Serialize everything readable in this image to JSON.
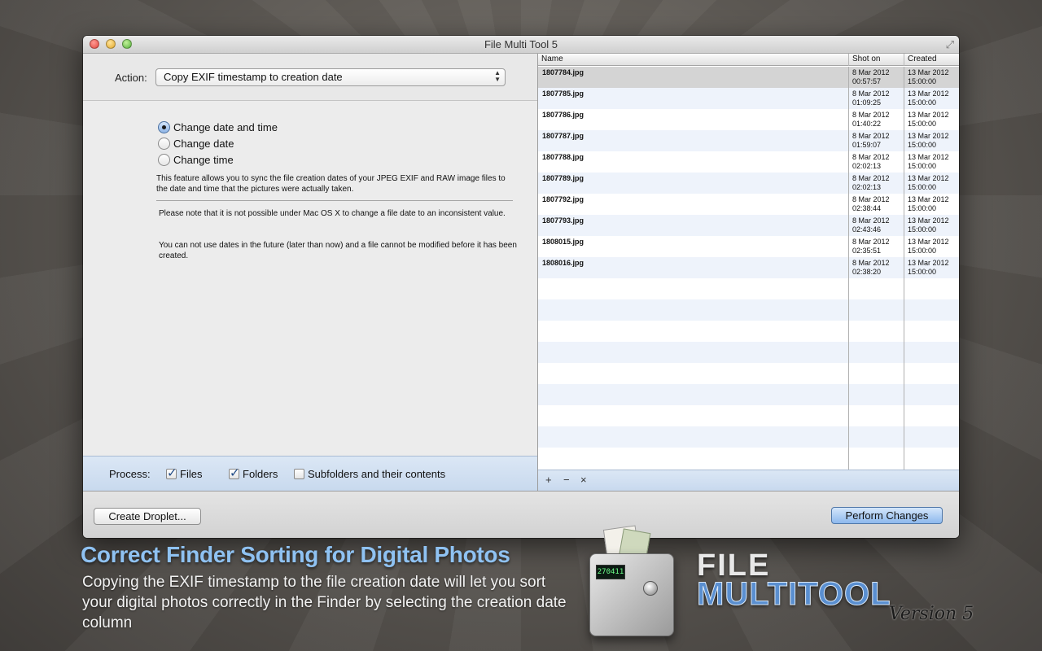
{
  "window": {
    "title": "File Multi Tool 5"
  },
  "action": {
    "label": "Action:",
    "selected": "Copy EXIF timestamp to creation date"
  },
  "radios": [
    {
      "label": "Change date and time",
      "selected": true
    },
    {
      "label": "Change date",
      "selected": false
    },
    {
      "label": "Change time",
      "selected": false
    }
  ],
  "description": "This feature allows you to sync the file creation dates of your JPEG EXIF and RAW image files to the date and time that the pictures were actually taken.",
  "notes": [
    "Please note that it is not possible under Mac OS X to change a file date to an inconsistent value.",
    "You can not use dates in the future (later than now) and a file cannot be modified before it has been created."
  ],
  "process": {
    "label": "Process:",
    "options": [
      {
        "label": "Files",
        "checked": true
      },
      {
        "label": "Folders",
        "checked": true
      },
      {
        "label": "Subfolders and their contents",
        "checked": false
      }
    ]
  },
  "table": {
    "columns": [
      "Name",
      "Shot on",
      "Created"
    ],
    "rows": [
      {
        "name": "1807784.jpg",
        "shot_date": "8 Mar 2012",
        "shot_time": "00:57:57",
        "created_date": "13 Mar 2012",
        "created_time": "15:00:00",
        "selected": true
      },
      {
        "name": "1807785.jpg",
        "shot_date": "8 Mar 2012",
        "shot_time": "01:09:25",
        "created_date": "13 Mar 2012",
        "created_time": "15:00:00"
      },
      {
        "name": "1807786.jpg",
        "shot_date": "8 Mar 2012",
        "shot_time": "01:40:22",
        "created_date": "13 Mar 2012",
        "created_time": "15:00:00"
      },
      {
        "name": "1807787.jpg",
        "shot_date": "8 Mar 2012",
        "shot_time": "01:59:07",
        "created_date": "13 Mar 2012",
        "created_time": "15:00:00"
      },
      {
        "name": "1807788.jpg",
        "shot_date": "8 Mar 2012",
        "shot_time": "02:02:13",
        "created_date": "13 Mar 2012",
        "created_time": "15:00:00"
      },
      {
        "name": "1807789.jpg",
        "shot_date": "8 Mar 2012",
        "shot_time": "02:02:13",
        "created_date": "13 Mar 2012",
        "created_time": "15:00:00"
      },
      {
        "name": "1807792.jpg",
        "shot_date": "8 Mar 2012",
        "shot_time": "02:38:44",
        "created_date": "13 Mar 2012",
        "created_time": "15:00:00"
      },
      {
        "name": "1807793.jpg",
        "shot_date": "8 Mar 2012",
        "shot_time": "02:43:46",
        "created_date": "13 Mar 2012",
        "created_time": "15:00:00"
      },
      {
        "name": "1808015.jpg",
        "shot_date": "8 Mar 2012",
        "shot_time": "02:35:51",
        "created_date": "13 Mar 2012",
        "created_time": "15:00:00"
      },
      {
        "name": "1808016.jpg",
        "shot_date": "8 Mar 2012",
        "shot_time": "02:38:20",
        "created_date": "13 Mar 2012",
        "created_time": "15:00:00"
      }
    ]
  },
  "list_toolbar": {
    "add": "+",
    "remove": "−",
    "clear": "×"
  },
  "buttons": {
    "create_droplet": "Create Droplet...",
    "perform_changes": "Perform Changes"
  },
  "caption": {
    "title": "Correct Finder Sorting for Digital Photos",
    "body": "Copying the EXIF timestamp to the file creation date will let you sort your digital photos correctly in the Finder by selecting the creation date column"
  },
  "device": {
    "screen_text": "270411"
  },
  "logo": {
    "line1": "FILE",
    "line2": "MULTITOOL",
    "version": "Version 5"
  },
  "colors": {
    "accent_blue": "#8fc2f2",
    "selection_gray": "#d4d4d4",
    "toolbar_blue": "#c8d9ee"
  }
}
